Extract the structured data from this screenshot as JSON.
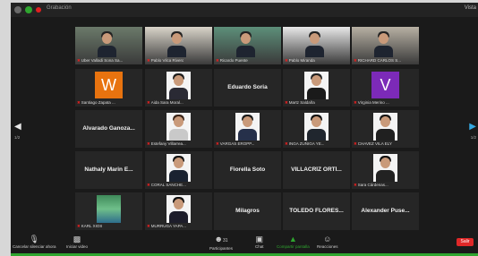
{
  "app": {
    "title": "Grabación",
    "view_label": "Vista"
  },
  "colors": {
    "active_speaker": "#c8d33a",
    "accent_green": "#2fa62f",
    "leave_red": "#e02828",
    "mic_muted": "#e02020",
    "nav_arrow": "#33a7e0"
  },
  "participants": [
    {
      "name": "Uber Valladi Sona Sa...",
      "kind": "video",
      "speaking": true
    },
    {
      "name": "Pablo Vilca Rivero",
      "kind": "video"
    },
    {
      "name": "Ricardo Puente",
      "kind": "video"
    },
    {
      "name": "Pablo Miranda",
      "kind": "video"
    },
    {
      "name": "RICHARD CARLOS S...",
      "kind": "video"
    },
    {
      "name": "Santiago Zapata ...",
      "kind": "avatar",
      "letter": "W",
      "color": "#e8730f"
    },
    {
      "name": "Aida Sara Moral...",
      "kind": "photo",
      "hair": "#1c1c1c",
      "body": "#2a2a34"
    },
    {
      "name": "",
      "kind": "name",
      "display": "Eduardo Soria"
    },
    {
      "name": "Martz Saldaña",
      "kind": "photo",
      "hair": "#222",
      "body": "#1a1a1a"
    },
    {
      "name": "Virginia Merino ...",
      "kind": "avatar",
      "letter": "V",
      "color": "#7c2ab8"
    },
    {
      "name": "",
      "kind": "name",
      "display": "Alvarado Ganoza..."
    },
    {
      "name": "Estefany Villarrea...",
      "kind": "photo",
      "hair": "#3a2418",
      "body": "#c9c9c9"
    },
    {
      "name": "VARGAS EROPP...",
      "kind": "photo",
      "hair": "#1a1a1a",
      "body": "#26304a"
    },
    {
      "name": "INGA ZUÑIGA YE...",
      "kind": "photo",
      "hair": "#111",
      "body": "#20262e"
    },
    {
      "name": "CHAVEZ VILA ELY",
      "kind": "photo",
      "hair": "#161616",
      "body": "#202020"
    },
    {
      "name": "",
      "kind": "name",
      "display": "Nathaly Marin E..."
    },
    {
      "name": "CORAL SANCHE...",
      "kind": "photo",
      "hair": "#131313",
      "body": "#1a2230"
    },
    {
      "name": "",
      "kind": "name",
      "display": "Fiorella Soto"
    },
    {
      "name": "",
      "kind": "name",
      "display": "VILLACRÍZ ORTÍ..."
    },
    {
      "name": "Sara Cárdenas...",
      "kind": "photo",
      "hair": "#111",
      "body": "#222"
    },
    {
      "name": "KARL XIOS",
      "kind": "nature"
    },
    {
      "name": "MURRUGA YAPA...",
      "kind": "photo",
      "hair": "#0f0f0f",
      "body": "#1d1d2a"
    },
    {
      "name": "",
      "kind": "name",
      "display": "Milagros"
    },
    {
      "name": "",
      "kind": "name",
      "display": "TOLEDO FLORES..."
    },
    {
      "name": "",
      "kind": "name",
      "display": "Alexander Puse..."
    }
  ],
  "pagination": {
    "left": "1/2",
    "right": "1/2"
  },
  "toolbar": {
    "mute": {
      "label": "Cancelar silenciar ahora",
      "icon": "microphone-icon"
    },
    "video": {
      "label": "Iniciar video",
      "icon": "video-camera-icon"
    },
    "participants": {
      "label": "Participantes",
      "count": "31",
      "icon": "participants-icon"
    },
    "chat": {
      "label": "Chat",
      "icon": "chat-icon"
    },
    "share": {
      "label": "Compartir pantalla",
      "icon": "share-screen-icon"
    },
    "reactions": {
      "label": "Reacciones",
      "icon": "reactions-icon"
    },
    "leave": {
      "label": "Salir"
    }
  }
}
